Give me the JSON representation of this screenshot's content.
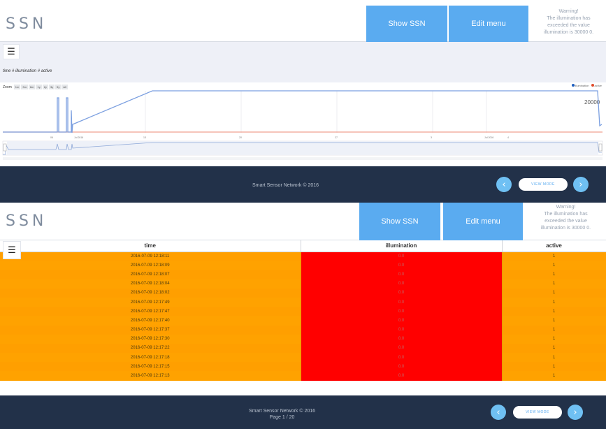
{
  "screen_top": {
    "header": {
      "logo": "SSN",
      "show_ssn_label": "Show SSN",
      "edit_menu_label": "Edit menu",
      "warning": [
        "Warning!",
        "The illumination has",
        "exceeded the value",
        "illumination is 30000 0."
      ]
    },
    "menu_icon": "menu-icon",
    "series_legend": "time # illumination # active",
    "zoom": {
      "label": "Zoom",
      "options": [
        "1m",
        "3m",
        "6m",
        "1y",
        "2y",
        "3y",
        "5y",
        "All"
      ]
    },
    "chart_legend": [
      {
        "name": "illumination",
        "color": "#1f5fbf"
      },
      {
        "name": "active",
        "color": "#e04a2a"
      }
    ],
    "y_value_label": "20000",
    "footer": {
      "text": "Smart Sensor Network © 2016",
      "view_mode_label": "VIEW MODE",
      "prev_icon": "chevron-left-icon",
      "next_icon": "chevron-right-icon"
    }
  },
  "chart_data": {
    "type": "line",
    "title": "",
    "series": [
      {
        "name": "illumination",
        "color": "#7b9fe0"
      },
      {
        "name": "active",
        "color": "#f0a090"
      }
    ],
    "y_labels": [
      "20000"
    ]
  },
  "screen_bottom": {
    "header": {
      "logo": "SSN",
      "show_ssn_label": "Show SSN",
      "edit_menu_label": "Edit menu",
      "warning": [
        "Warning!",
        "The illumination has",
        "exceeded the value",
        "illumination is 30000 0."
      ]
    },
    "table": {
      "columns": [
        "time",
        "illumination",
        "active"
      ],
      "rows": [
        [
          "2016-07-09 12:18:11",
          "0.0",
          "1"
        ],
        [
          "2016-07-09 12:18:09",
          "0.0",
          "1"
        ],
        [
          "2016-07-09 12:18:07",
          "0.0",
          "1"
        ],
        [
          "2016-07-09 12:18:04",
          "0.0",
          "1"
        ],
        [
          "2016-07-09 12:18:02",
          "0.0",
          "1"
        ],
        [
          "2016-07-09 12:17:49",
          "0.0",
          "1"
        ],
        [
          "2016-07-09 12:17:47",
          "0.0",
          "1"
        ],
        [
          "2016-07-09 12:17:40",
          "0.0",
          "1"
        ],
        [
          "2016-07-09 12:17:37",
          "0.0",
          "1"
        ],
        [
          "2016-07-09 12:17:30",
          "0.0",
          "1"
        ],
        [
          "2016-07-09 12:17:22",
          "0.0",
          "1"
        ],
        [
          "2016-07-09 12:17:18",
          "0.0",
          "1"
        ],
        [
          "2016-07-09 12:17:15",
          "0.0",
          "1"
        ],
        [
          "2016-07-09 12:17:13",
          "0.0",
          "1"
        ]
      ]
    },
    "footer": {
      "text": "Smart Sensor Network © 2016",
      "page_text": "Page 1 / 20",
      "view_mode_label": "VIEW MODE"
    }
  },
  "colors": {
    "accent": "#5aabf0",
    "footer_bg": "#223149",
    "row_orange": "#ffa200",
    "row_red": "#ff0000"
  }
}
